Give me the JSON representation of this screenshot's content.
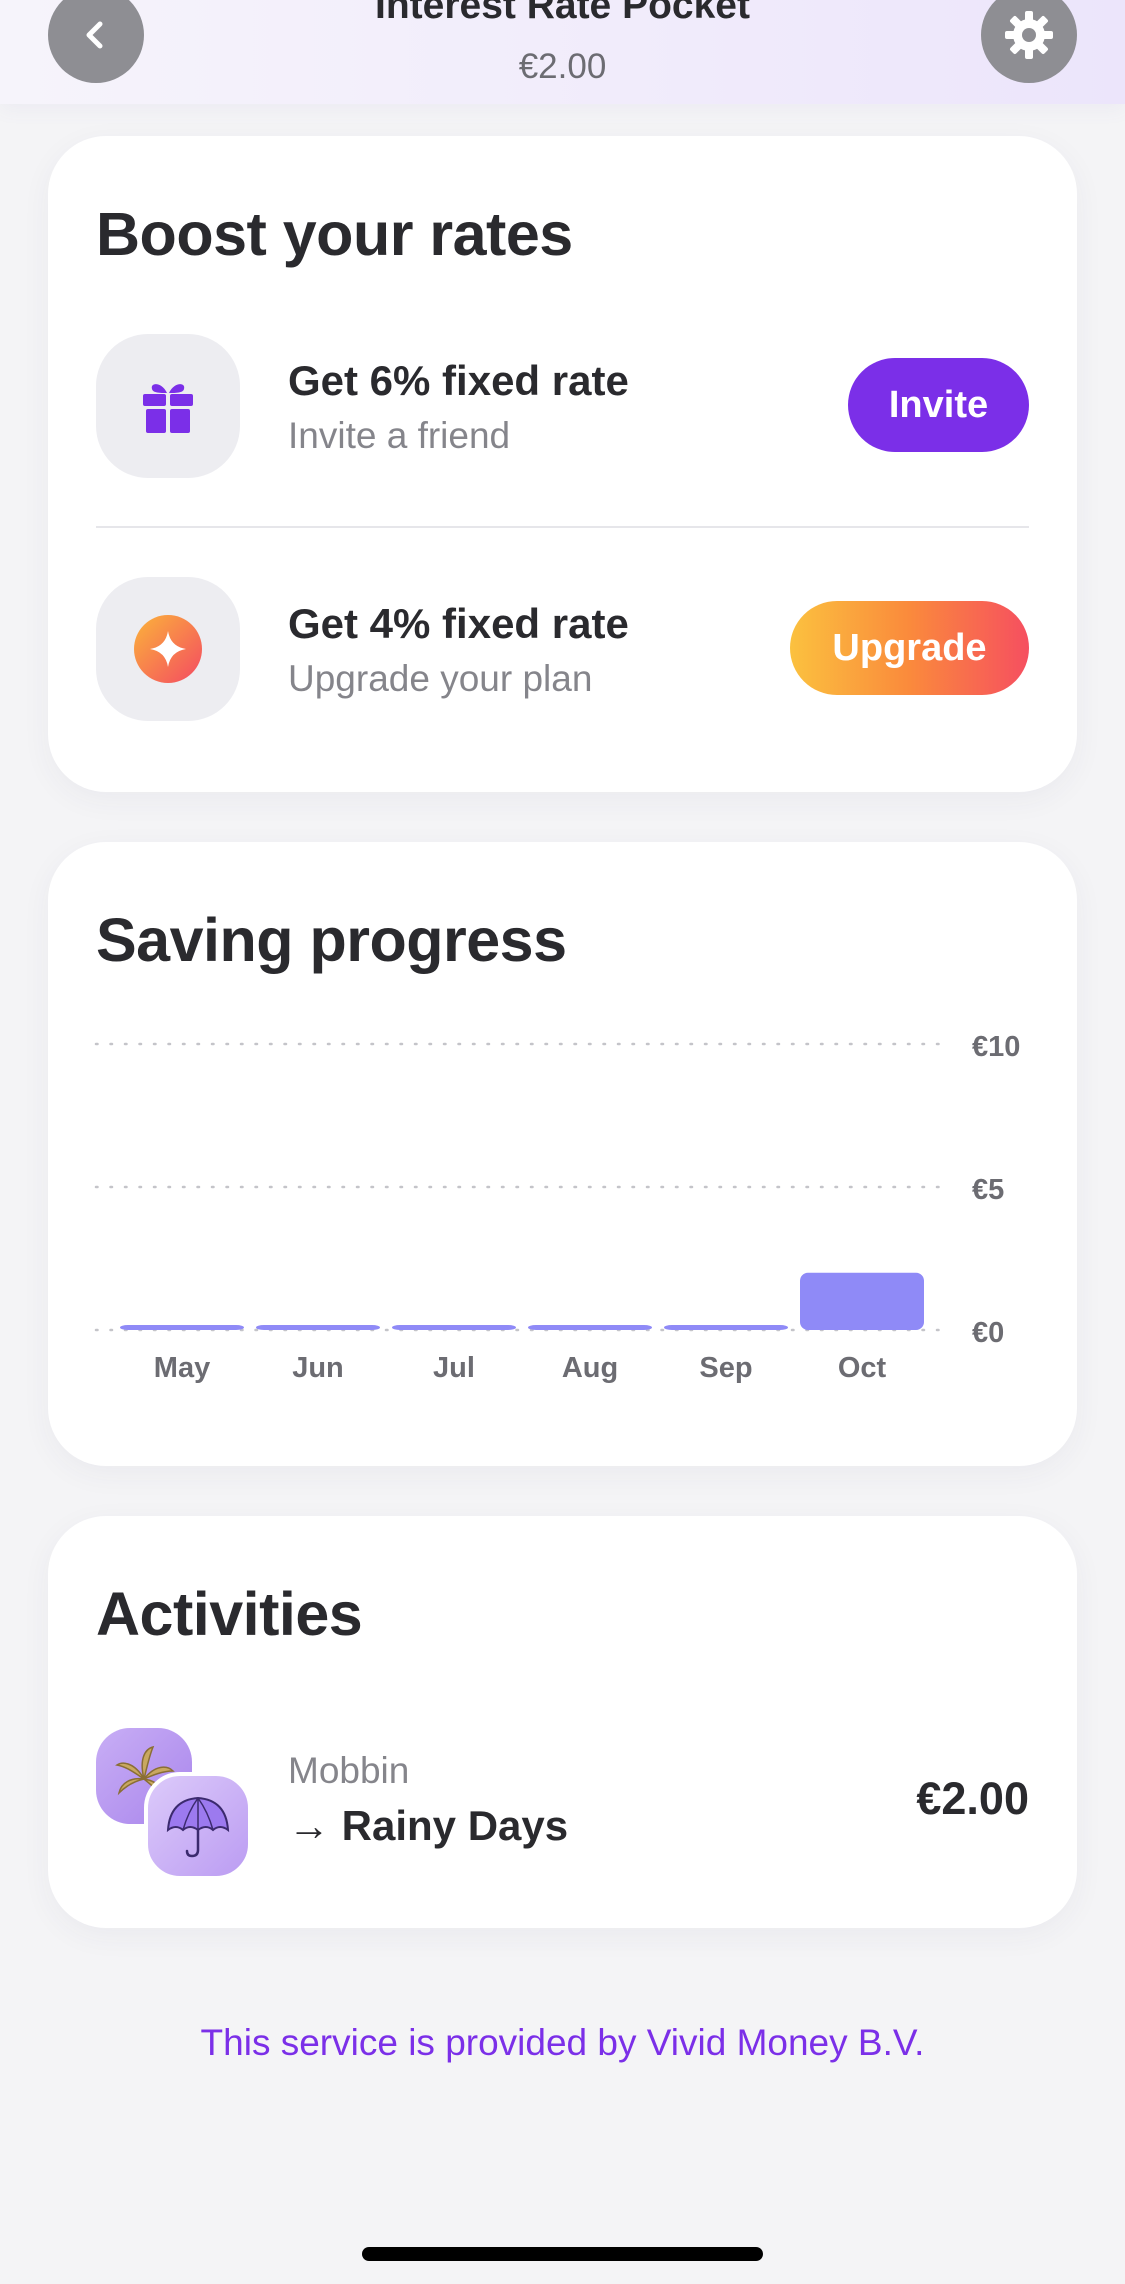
{
  "header": {
    "title": "Interest Rate Pocket",
    "amount": "€2.00",
    "back_icon": "chevron-left-icon",
    "settings_icon": "gear-icon"
  },
  "boost": {
    "title": "Boost your rates",
    "offers": [
      {
        "icon": "gift-icon",
        "title": "Get 6% fixed rate",
        "subtitle": "Invite a friend",
        "button_label": "Invite",
        "button_color": "#7b2fe8"
      },
      {
        "icon": "sparkle-icon",
        "title": "Get 4% fixed rate",
        "subtitle": "Upgrade your plan",
        "button_label": "Upgrade",
        "button_color": "#fa8a3c"
      }
    ]
  },
  "progress": {
    "title": "Saving progress"
  },
  "chart_data": {
    "type": "bar",
    "categories": [
      "May",
      "Jun",
      "Jul",
      "Aug",
      "Sep",
      "Oct"
    ],
    "values": [
      0,
      0,
      0,
      0,
      0,
      2
    ],
    "y_ticks": [
      "€10",
      "€5",
      "€0"
    ],
    "y_tick_values": [
      10,
      5,
      0
    ],
    "ylim": [
      0,
      10
    ],
    "grid": true,
    "bar_color": "#8f8af7",
    "legend": "none"
  },
  "activities": {
    "title": "Activities",
    "items": [
      {
        "merchant": "Mobbin",
        "destination": "→ Rainy Days",
        "amount": "€2.00"
      }
    ]
  },
  "footer": {
    "note": "This service is provided by Vivid Money B.V."
  },
  "colors": {
    "accent": "#7b2fe8",
    "bar": "#8f8af7"
  }
}
